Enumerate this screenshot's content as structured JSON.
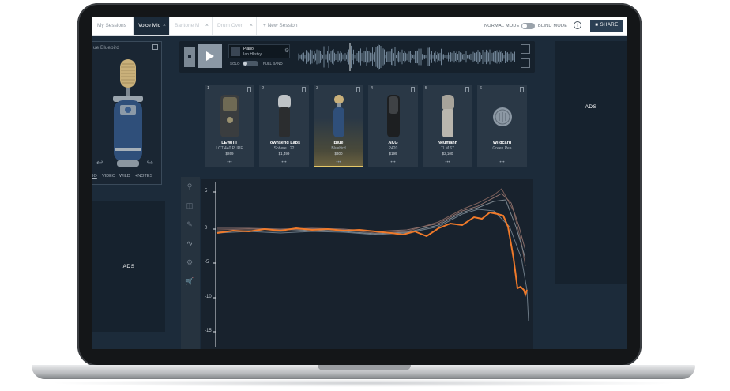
{
  "tabs": [
    {
      "label": "My Sessions"
    },
    {
      "label": "Voice Mic",
      "close": "×"
    },
    {
      "label": "Baritone M",
      "close": "×"
    },
    {
      "label": "Drum Over",
      "close": "×"
    }
  ],
  "new_session": "+ New Session",
  "modes": {
    "normal": "NORMAL MODE",
    "blind": "BLIND MODE"
  },
  "info": "i",
  "share": "SHARE",
  "left_panel": {
    "title": "ue Bluebird",
    "tabs": [
      "IO",
      "VIDEO",
      "WILD",
      "+NOTES"
    ]
  },
  "ads": "ADS",
  "player": {
    "track_title": "Piano",
    "track_artist": "Ian Hlistky",
    "solo": "SOLO",
    "full_band": "FULL BAND"
  },
  "mics": [
    {
      "num": "1",
      "brand": "LEWITT",
      "model": "LCT 440 PURE",
      "price": "$269",
      "dots": "•••"
    },
    {
      "num": "2",
      "brand": "Townsend Labs",
      "model": "Sphere L22",
      "price": "$1,499",
      "dots": "•••"
    },
    {
      "num": "3",
      "brand": "Blue",
      "model": "Bluebird",
      "price": "$300",
      "dots": "•••"
    },
    {
      "num": "4",
      "brand": "AKG",
      "model": "P420",
      "price": "$199",
      "dots": "•••"
    },
    {
      "num": "5",
      "brand": "Neumann",
      "model": "TLM 67",
      "price": "$2,100",
      "dots": "•••"
    },
    {
      "num": "6",
      "brand": "Wildcard",
      "model": "Green Pea",
      "price": "",
      "dots": "•••"
    }
  ],
  "graph": {
    "y_ticks": [
      "5",
      "0",
      "-5",
      "-10",
      "-15"
    ]
  },
  "colors": {
    "accent": "#f07a2a",
    "selected": "#e6c96a",
    "bg": "#1c2b3a"
  }
}
